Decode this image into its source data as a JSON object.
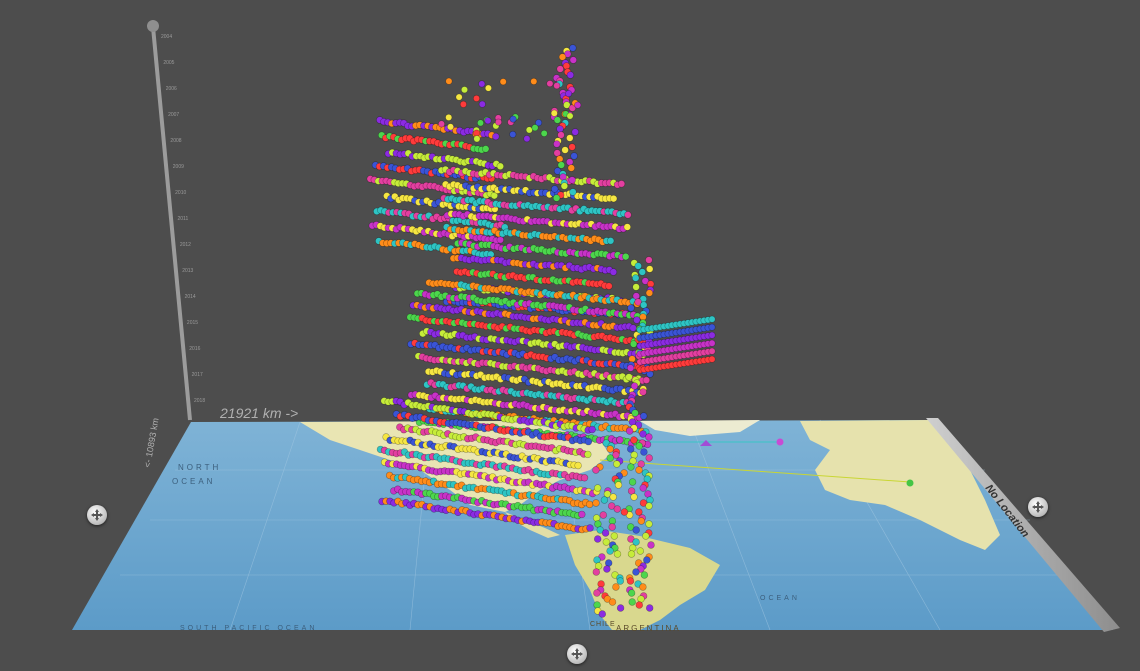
{
  "scale": {
    "width_label": "21921 km ->",
    "depth_label": "<- 10893 km",
    "time_ticks": [
      "2004",
      "2005",
      "2006",
      "2007",
      "2008",
      "2009",
      "2010",
      "2011",
      "2012",
      "2013",
      "2014",
      "2015",
      "2016",
      "2017",
      "2018"
    ]
  },
  "map": {
    "ocean_labels": [
      "NORTH",
      "OCEAN",
      "SOUTH PACIFIC OCEAN",
      "OCEAN"
    ],
    "country_labels": [
      "ARGENTINA",
      "CHILE"
    ],
    "no_location_label": "No Location"
  },
  "controls": {
    "nav_left": "pan-left",
    "nav_right": "pan-right",
    "nav_bottom": "pan-down"
  },
  "colors": {
    "background": "#4d4d4d",
    "ocean": "#6fa7cf",
    "land": "#e7e3b0",
    "axis": "#b9b9b9",
    "palette": [
      "#8b2be2",
      "#c832c8",
      "#e33fa0",
      "#ff3b3b",
      "#ff8c1a",
      "#f5e642",
      "#c6ec3a",
      "#4cd64c",
      "#2ec4c4",
      "#3a54d6"
    ]
  }
}
